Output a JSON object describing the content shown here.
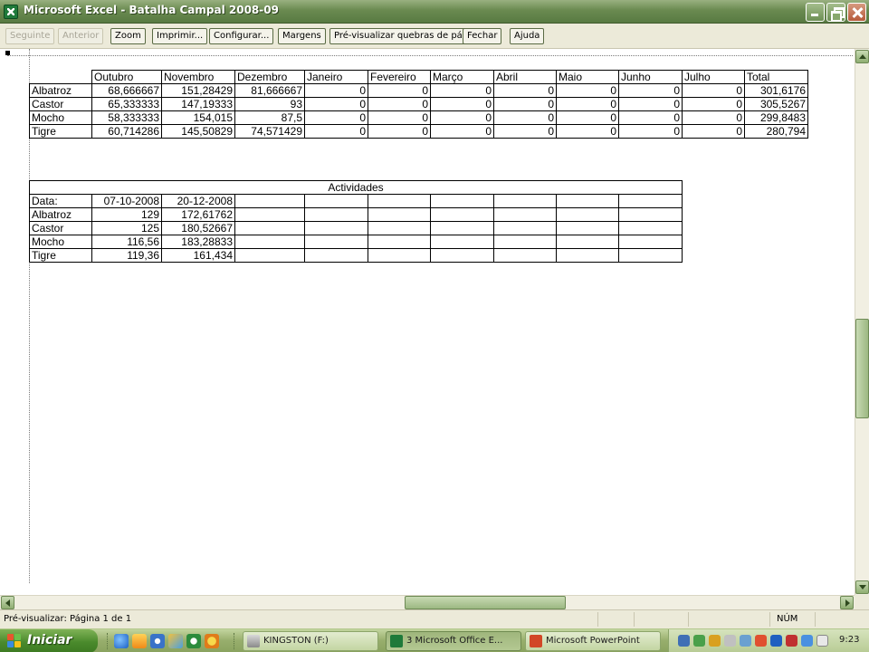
{
  "window": {
    "title": "Microsoft Excel - Batalha Campal 2008-09"
  },
  "toolbar": {
    "buttons": [
      {
        "label": "Seguinte",
        "enabled": false
      },
      {
        "label": "Anterior",
        "enabled": false
      },
      {
        "label": "Zoom",
        "enabled": true
      },
      {
        "label": "Imprimir...",
        "enabled": true
      },
      {
        "label": "Configurar...",
        "enabled": true
      },
      {
        "label": "Margens",
        "enabled": true
      },
      {
        "label": "Pré-visualizar quebras de pág",
        "enabled": true
      },
      {
        "label": "Fechar",
        "enabled": true
      },
      {
        "label": "Ajuda",
        "enabled": true
      }
    ]
  },
  "table1": {
    "headers": [
      "",
      "Outubro",
      "Novembro",
      "Dezembro",
      "Janeiro",
      "Fevereiro",
      "Março",
      "Abril",
      "Maio",
      "Junho",
      "Julho",
      "Total"
    ],
    "rows": [
      [
        "Albatroz",
        "68,666667",
        "151,28429",
        "81,666667",
        "0",
        "0",
        "0",
        "0",
        "0",
        "0",
        "0",
        "301,6176"
      ],
      [
        "Castor",
        "65,333333",
        "147,19333",
        "93",
        "0",
        "0",
        "0",
        "0",
        "0",
        "0",
        "0",
        "305,5267"
      ],
      [
        "Mocho",
        "58,333333",
        "154,015",
        "87,5",
        "0",
        "0",
        "0",
        "0",
        "0",
        "0",
        "0",
        "299,8483"
      ],
      [
        "Tigre",
        "60,714286",
        "145,50829",
        "74,571429",
        "0",
        "0",
        "0",
        "0",
        "0",
        "0",
        "0",
        "280,794"
      ]
    ]
  },
  "table2": {
    "title": "Actividades",
    "date_label": "Data:",
    "dates": [
      "07-10-2008",
      "20-12-2008"
    ],
    "rows": [
      [
        "Albatroz",
        "129",
        "172,61762"
      ],
      [
        "Castor",
        "125",
        "180,52667"
      ],
      [
        "Mocho",
        "116,56",
        "183,28833"
      ],
      [
        "Tigre",
        "119,36",
        "161,434"
      ]
    ]
  },
  "status": {
    "text": "Pré-visualizar: Página 1 de 1",
    "num": "NÚM"
  },
  "taskbar": {
    "start_label": "Iniciar",
    "buttons": [
      {
        "label": "KINGSTON (F:)"
      },
      {
        "label": "3 Microsoft Office E..."
      },
      {
        "label": "Microsoft PowerPoint"
      }
    ],
    "clock": "9:23"
  }
}
